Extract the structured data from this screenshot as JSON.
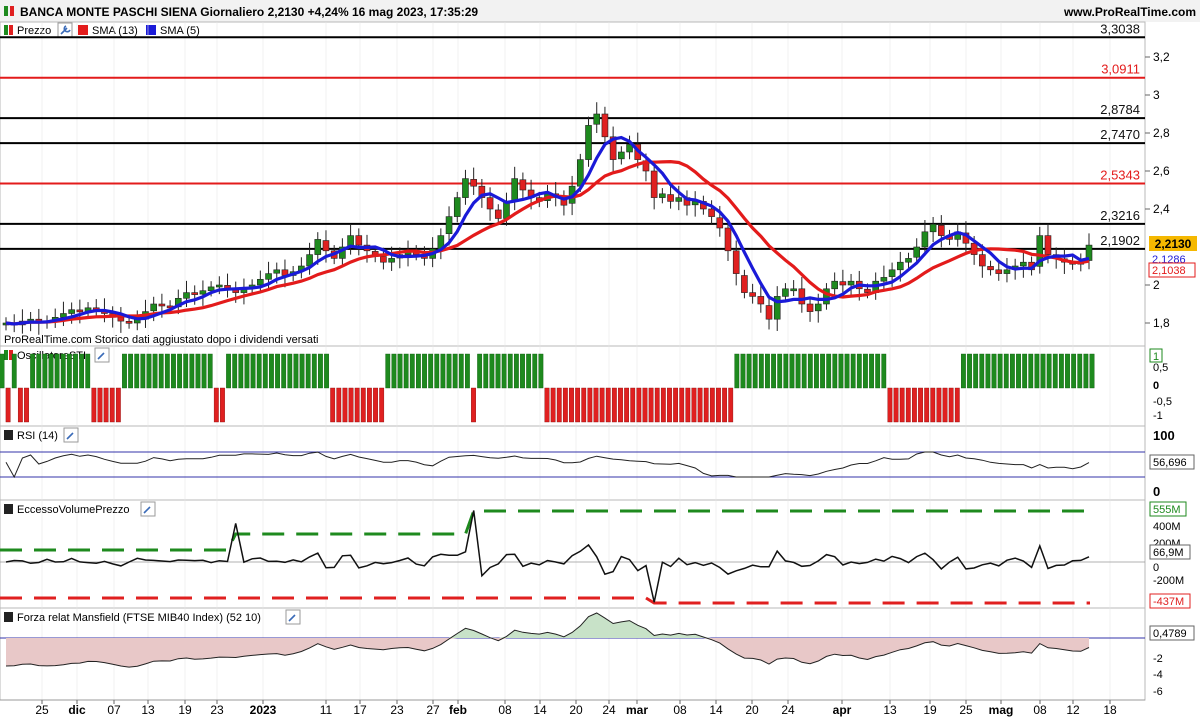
{
  "header": {
    "title": "BANCA MONTE PASCHI SIENA Giornaliero 2,2130 +4,24% 16 mag 2023, 17:35:29",
    "site": "www.ProRealTime.com"
  },
  "colors": {
    "up": "#1e8a1e",
    "down": "#e02020",
    "sma13": "#e31b1b",
    "sma5": "#1a1ad8",
    "grid": "#cccccc"
  },
  "icons": [
    "price-up-down-icon",
    "wrench-icon",
    "red-legend-square-icon",
    "blue-legend-square-icon"
  ],
  "note": "ProRealTime.com Storico dati aggiustato dopo i dividendi versati",
  "chart_data": [
    {
      "type": "candlestick",
      "legend": [
        "Prezzo",
        "SMA (13)",
        "SMA (5)"
      ],
      "ylim": [
        1.7,
        3.3
      ],
      "yticks": [
        "3,2",
        "3",
        "2,8",
        "2,6",
        "2,4",
        "2",
        "1,8"
      ],
      "hlines": [
        {
          "value": 3.3038,
          "label": "3,3038",
          "color": "#000000"
        },
        {
          "value": 3.0911,
          "label": "3,0911",
          "color": "#e31b1b"
        },
        {
          "value": 2.8784,
          "label": "2,8784",
          "color": "#000000"
        },
        {
          "value": 2.747,
          "label": "2,7470",
          "color": "#000000"
        },
        {
          "value": 2.5343,
          "label": "2,5343",
          "color": "#e31b1b"
        },
        {
          "value": 2.3216,
          "label": "2,3216",
          "color": "#000000"
        },
        {
          "value": 2.1902,
          "label": "2,1902",
          "color": "#000000"
        }
      ],
      "last_price": "2,2130",
      "sma5_value": "2,1286",
      "sma13_value": "2,1038",
      "xlabels": [
        "25",
        "dic",
        "07",
        "13",
        "19",
        "23",
        "2023",
        "11",
        "17",
        "23",
        "27",
        "feb",
        "08",
        "14",
        "20",
        "24",
        "mar",
        "08",
        "14",
        "20",
        "24",
        "apr",
        "13",
        "19",
        "25",
        "mag",
        "08",
        "12",
        "18"
      ],
      "close": [
        1.8,
        1.79,
        1.81,
        1.82,
        1.8,
        1.81,
        1.83,
        1.85,
        1.87,
        1.86,
        1.88,
        1.87,
        1.85,
        1.83,
        1.81,
        1.8,
        1.82,
        1.86,
        1.9,
        1.89,
        1.88,
        1.93,
        1.96,
        1.95,
        1.97,
        1.99,
        2.0,
        1.98,
        1.96,
        1.98,
        2.0,
        2.03,
        2.06,
        2.08,
        2.05,
        2.07,
        2.1,
        2.16,
        2.24,
        2.18,
        2.14,
        2.2,
        2.26,
        2.21,
        2.18,
        2.15,
        2.12,
        2.14,
        2.16,
        2.18,
        2.16,
        2.14,
        2.19,
        2.26,
        2.36,
        2.46,
        2.56,
        2.52,
        2.46,
        2.4,
        2.35,
        2.44,
        2.56,
        2.5,
        2.46,
        2.44,
        2.48,
        2.46,
        2.42,
        2.52,
        2.66,
        2.84,
        2.9,
        2.78,
        2.66,
        2.7,
        2.74,
        2.66,
        2.6,
        2.46,
        2.48,
        2.44,
        2.46,
        2.42,
        2.44,
        2.4,
        2.36,
        2.3,
        2.18,
        2.06,
        1.96,
        1.94,
        1.9,
        1.82,
        1.94,
        1.98,
        1.98,
        1.9,
        1.86,
        1.9,
        1.98,
        2.02,
        2.0,
        2.02,
        1.98,
        1.96,
        2.02,
        2.04,
        2.08,
        2.12,
        2.14,
        2.2,
        2.28,
        2.32,
        2.26,
        2.24,
        2.28,
        2.22,
        2.16,
        2.1,
        2.08,
        2.06,
        2.08,
        2.1,
        2.12,
        2.08,
        2.26,
        2.16,
        2.14,
        2.12,
        2.11,
        2.12,
        2.21
      ]
    },
    {
      "type": "bar",
      "title": "OscillatoreSTI",
      "ylim": [
        -1.2,
        1.2
      ],
      "yticks": [
        "0,5",
        "0",
        "-0,5",
        "-1"
      ],
      "last_label": "1",
      "values": [
        1,
        -1,
        1,
        -1,
        -1,
        1,
        1,
        1,
        1,
        1,
        1,
        1,
        1,
        1,
        1,
        -1,
        -1,
        -1,
        -1,
        -1,
        1,
        1,
        1,
        1,
        1,
        1,
        1,
        1,
        1,
        1,
        1,
        1,
        1,
        1,
        1,
        -1,
        -1,
        1,
        1,
        1,
        1,
        1,
        1,
        1,
        1,
        1,
        1,
        1,
        1,
        1,
        1,
        1,
        1,
        1,
        -1,
        -1,
        -1,
        -1,
        -1,
        -1,
        -1,
        -1,
        -1,
        1,
        1,
        1,
        1,
        1,
        1,
        1,
        1,
        1,
        1,
        1,
        1,
        1,
        1,
        -1,
        1,
        1,
        1,
        1,
        1,
        1,
        1,
        1,
        1,
        1,
        1,
        -1,
        -1,
        -1,
        -1,
        -1,
        -1,
        -1,
        -1,
        -1,
        -1,
        -1,
        -1,
        -1,
        -1,
        -1,
        -1,
        -1,
        -1,
        -1,
        -1,
        -1,
        -1,
        -1,
        -1,
        -1,
        -1,
        -1,
        -1,
        -1,
        -1,
        -1,
        1,
        1,
        1,
        1,
        1,
        1,
        1,
        1,
        1,
        1,
        1,
        1,
        1,
        1,
        1,
        1,
        1,
        1,
        1,
        1,
        1,
        1,
        1,
        1,
        1,
        -1,
        -1,
        -1,
        -1,
        -1,
        -1,
        -1,
        -1,
        -1,
        -1,
        -1,
        -1,
        1,
        1,
        1,
        1,
        1,
        1,
        1,
        1,
        1,
        1,
        1,
        1,
        1,
        1,
        1,
        1,
        1,
        1,
        1,
        1,
        1,
        1
      ]
    },
    {
      "type": "line",
      "title": "RSI (14)",
      "ylim": [
        0,
        100
      ],
      "yticks": [
        "100",
        "0"
      ],
      "last_label": "56,696"
    },
    {
      "type": "line",
      "title": "EccessoVolumePrezzo",
      "ylim": [
        -500,
        600
      ],
      "yticks": [
        "400M",
        "200M",
        "0",
        "-200M"
      ],
      "labels": {
        "top": "555M",
        "last": "66,9M",
        "bottom": "-437M"
      }
    },
    {
      "type": "area",
      "title": "Forza relat Mansfield (FTSE MIB40 Index) (52 10)",
      "ylim": [
        -7,
        2
      ],
      "yticks": [
        "-2",
        "-4",
        "-6"
      ],
      "last_label": "0,4789"
    }
  ]
}
